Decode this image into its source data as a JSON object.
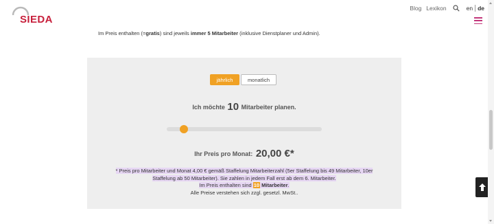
{
  "header": {
    "logo_text": "SIEDA",
    "nav": {
      "blog": "Blog",
      "lexikon": "Lexikon"
    },
    "lang": {
      "en": "en",
      "de": "de"
    }
  },
  "intro": {
    "part1": "Im Preis enthalten (=",
    "gratis": "gratis",
    "part2": ") sind jeweils ",
    "bold": "immer 5 Mitarbeiter",
    "part3": " (inklusive Dienstplaner und Admin)."
  },
  "calculator": {
    "billing": {
      "yearly": "jährlich",
      "monthly": "monatlich",
      "selected": "jährlich"
    },
    "employees": {
      "prefix": "Ich möchte",
      "count": "10",
      "suffix": "Mitarbeiter planen."
    },
    "slider": {
      "value": 10,
      "min": 1,
      "max": 100
    },
    "price": {
      "label": "Ihr Preis pro Monat:",
      "amount": "20,00 €*"
    },
    "notes": {
      "line1": "* Preis pro Mitarbeiter und Monat ",
      "line1_value": "4,00 €",
      "line1_rest": " gemäß Staffelung Mitarbeiterzahl (5er Staffelung bis 49 Mitarbeiter, 10er Staffelung ab 50 Mitarbeiter). Sie zahlen in jedem Fall erst ab dem 6. Mitarbeiter.",
      "line2_prefix": "Im Preis enthalten sind ",
      "line2_count": "10",
      "line2_bold": " Mitarbeiter",
      "line2_end": ".",
      "line3": "Alle Preise verstehen sich zzgl. gesetzl. MwSt.."
    }
  },
  "colors": {
    "brand": "#c71f3b",
    "accent": "#f0a124",
    "menu": "#c2357a",
    "highlight": "#e6d6f3"
  },
  "icons": {
    "search": "search-icon",
    "menu": "hamburger-menu-icon",
    "back_to_top": "arrow-up-icon"
  }
}
